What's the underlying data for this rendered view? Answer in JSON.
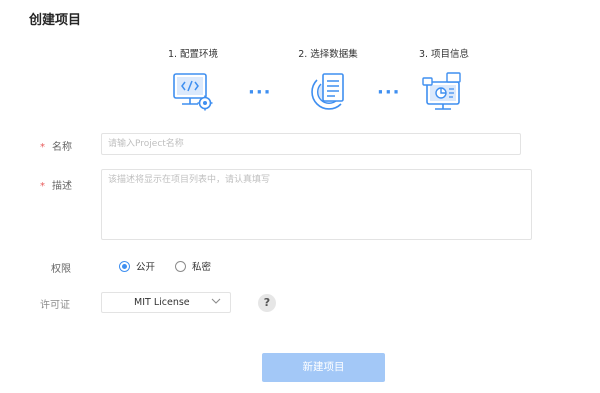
{
  "page": {
    "title": "创建项目"
  },
  "steps": [
    {
      "label": "1. 配置环境",
      "icon": "code-monitor-gear-icon"
    },
    {
      "label": "2. 选择数据集",
      "icon": "dataset-document-icon"
    },
    {
      "label": "3. 项目信息",
      "icon": "project-dashboard-icon"
    }
  ],
  "form": {
    "required_mark": "*",
    "name": {
      "label": "名称",
      "placeholder": "请输入Project名称",
      "value": ""
    },
    "description": {
      "label": "描述",
      "placeholder": "该描述将显示在项目列表中，请认真填写",
      "value": ""
    },
    "permission": {
      "label": "权限",
      "options": [
        {
          "label": "公开",
          "checked": true
        },
        {
          "label": "私密",
          "checked": false
        }
      ]
    },
    "license": {
      "label": "许可证",
      "selected": "MIT License",
      "help_icon": "question-icon",
      "help_text": "?"
    }
  },
  "submit": {
    "label": "新建项目"
  },
  "colors": {
    "accent": "#3f8ff0",
    "required": "#e85c5c",
    "submit_bg": "#a3c8f7"
  }
}
